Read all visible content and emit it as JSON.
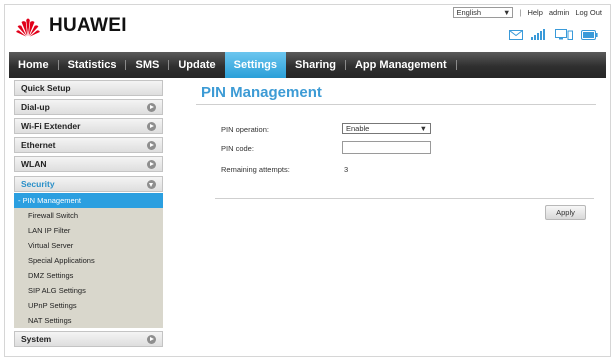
{
  "header": {
    "brand": "HUAWEI",
    "language": "English",
    "help": "Help",
    "user": "admin",
    "logout": "Log Out",
    "status_icons": [
      "mail-icon",
      "signal-icon",
      "network-icon",
      "battery-icon"
    ]
  },
  "nav": {
    "items": [
      {
        "label": "Home"
      },
      {
        "label": "Statistics"
      },
      {
        "label": "SMS"
      },
      {
        "label": "Update"
      },
      {
        "label": "Settings",
        "active": true
      },
      {
        "label": "Sharing"
      },
      {
        "label": "App Management"
      }
    ]
  },
  "sidebar": {
    "menus": [
      {
        "label": "Quick Setup"
      },
      {
        "label": "Dial-up"
      },
      {
        "label": "Wi-Fi Extender"
      },
      {
        "label": "Ethernet"
      },
      {
        "label": "WLAN"
      },
      {
        "label": "Security",
        "open": true
      },
      {
        "label": "System"
      }
    ],
    "security_items": [
      {
        "label": "- PIN Management",
        "active": true
      },
      {
        "label": "Firewall Switch"
      },
      {
        "label": "LAN IP Filter"
      },
      {
        "label": "Virtual Server"
      },
      {
        "label": "Special Applications"
      },
      {
        "label": "DMZ Settings"
      },
      {
        "label": "SIP ALG Settings"
      },
      {
        "label": "UPnP Settings"
      },
      {
        "label": "NAT Settings"
      }
    ]
  },
  "main": {
    "title": "PIN Management",
    "pin_operation_label": "PIN operation:",
    "pin_operation_value": "Enable",
    "pin_code_label": "PIN code:",
    "pin_code_value": "",
    "remaining_label": "Remaining attempts:",
    "remaining_value": "3",
    "apply_label": "Apply"
  },
  "colors": {
    "accent": "#2a9fd8",
    "title": "#3d9bd5",
    "brand_red": "#e1001a"
  }
}
